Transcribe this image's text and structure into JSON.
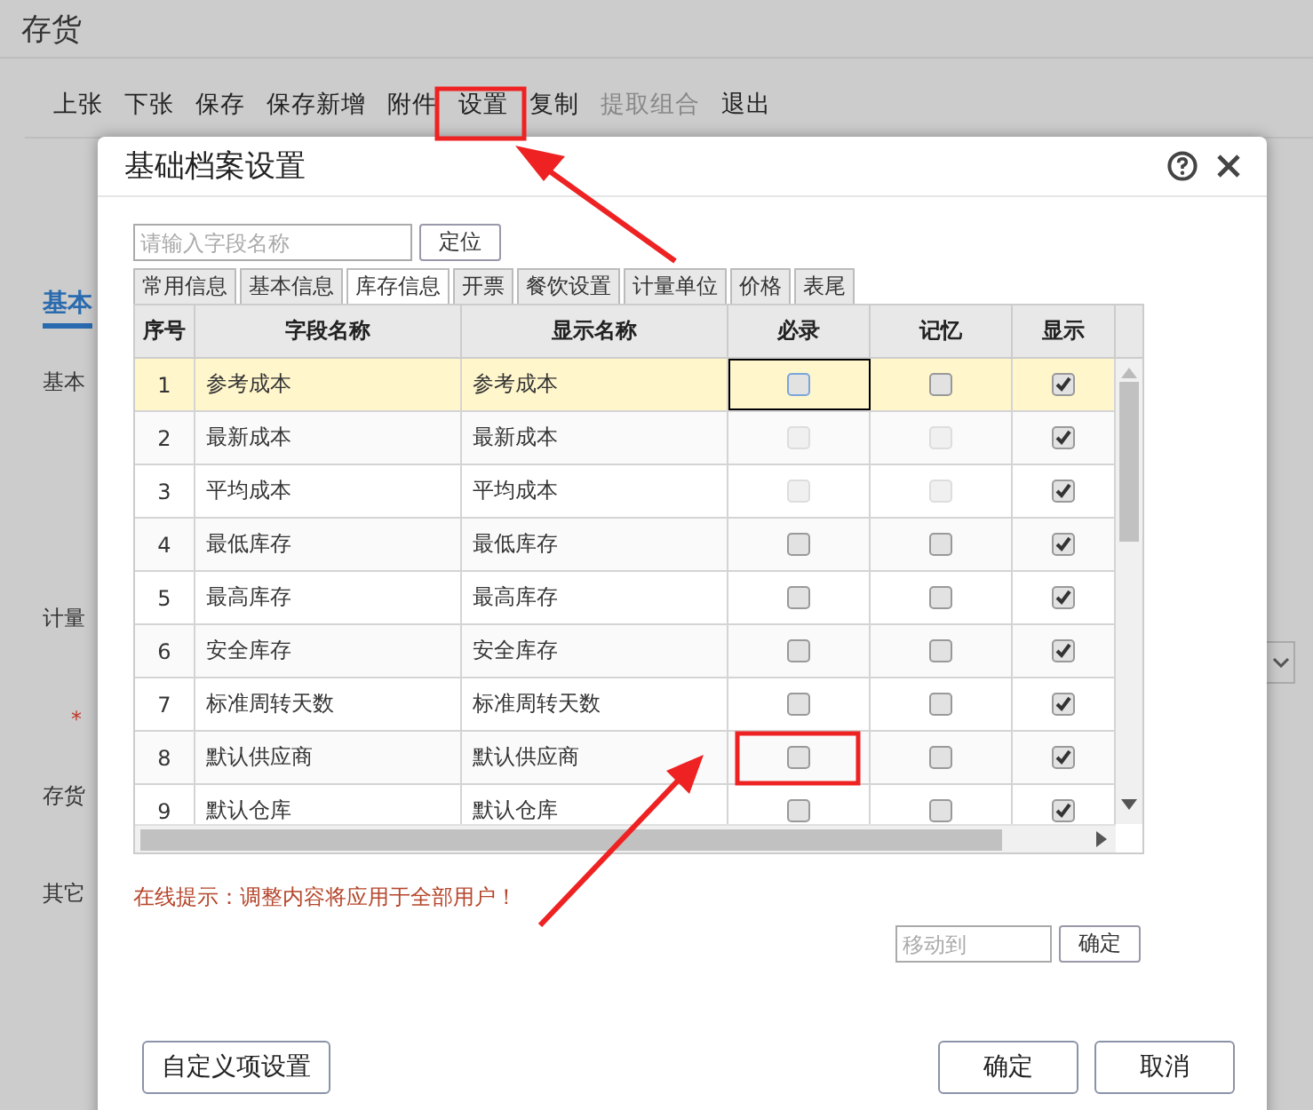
{
  "page": {
    "title": "存货",
    "toolbar": [
      {
        "label": "上张",
        "disabled": false
      },
      {
        "label": "下张",
        "disabled": false
      },
      {
        "label": "保存",
        "disabled": false
      },
      {
        "label": "保存新增",
        "disabled": false
      },
      {
        "label": "附件",
        "disabled": false
      },
      {
        "label": "设置",
        "disabled": false
      },
      {
        "label": "复制",
        "disabled": false
      },
      {
        "label": "提取组合",
        "disabled": true
      },
      {
        "label": "退出",
        "disabled": false
      }
    ],
    "tab": "基本",
    "labels": [
      {
        "text": "基本",
        "required": false
      },
      {
        "text": "计量",
        "required": false
      },
      {
        "text": "*",
        "required": true
      },
      {
        "text": "存货",
        "required": false
      },
      {
        "text": "其它",
        "required": false
      }
    ]
  },
  "dialog": {
    "title": "基础档案设置",
    "search": {
      "placeholder": "请输入字段名称",
      "button": "定位"
    },
    "tabs": [
      {
        "label": "常用信息",
        "selected": false
      },
      {
        "label": "基本信息",
        "selected": false
      },
      {
        "label": "库存信息",
        "selected": true
      },
      {
        "label": "开票",
        "selected": false
      },
      {
        "label": "餐饮设置",
        "selected": false
      },
      {
        "label": "计量单位",
        "selected": false
      },
      {
        "label": "价格",
        "selected": false
      },
      {
        "label": "表尾",
        "selected": false
      }
    ],
    "columns": [
      "序号",
      "字段名称",
      "显示名称",
      "必录",
      "记忆",
      "显示"
    ],
    "rows": [
      {
        "no": "1",
        "field": "参考成本",
        "display": "参考成本",
        "selected": true,
        "disabled": false,
        "required": false,
        "remember": false,
        "show": true
      },
      {
        "no": "2",
        "field": "最新成本",
        "display": "最新成本",
        "selected": false,
        "disabled": true,
        "required": false,
        "remember": false,
        "show": true
      },
      {
        "no": "3",
        "field": "平均成本",
        "display": "平均成本",
        "selected": false,
        "disabled": true,
        "required": false,
        "remember": false,
        "show": true
      },
      {
        "no": "4",
        "field": "最低库存",
        "display": "最低库存",
        "selected": false,
        "disabled": false,
        "required": false,
        "remember": false,
        "show": true
      },
      {
        "no": "5",
        "field": "最高库存",
        "display": "最高库存",
        "selected": false,
        "disabled": false,
        "required": false,
        "remember": false,
        "show": true
      },
      {
        "no": "6",
        "field": "安全库存",
        "display": "安全库存",
        "selected": false,
        "disabled": false,
        "required": false,
        "remember": false,
        "show": true
      },
      {
        "no": "7",
        "field": "标准周转天数",
        "display": "标准周转天数",
        "selected": false,
        "disabled": false,
        "required": false,
        "remember": false,
        "show": true
      },
      {
        "no": "8",
        "field": "默认供应商",
        "display": "默认供应商",
        "selected": false,
        "disabled": false,
        "required": false,
        "remember": false,
        "show": true
      },
      {
        "no": "9",
        "field": "默认仓库",
        "display": "默认仓库",
        "selected": false,
        "disabled": false,
        "required": false,
        "remember": false,
        "show": true
      }
    ],
    "hint": "在线提示：调整内容将应用于全部用户！",
    "move": {
      "placeholder": "移动到",
      "button": "确定"
    },
    "buttons": {
      "custom": "自定义项设置",
      "ok": "确定",
      "cancel": "取消"
    }
  }
}
